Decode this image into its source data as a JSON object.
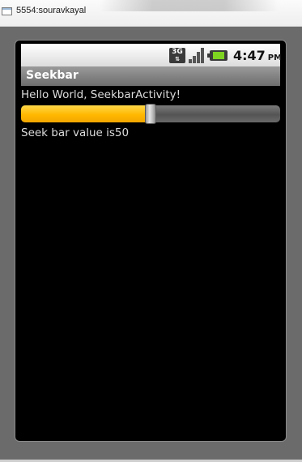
{
  "window": {
    "title": "5554:souravkayal"
  },
  "statusbar": {
    "network": "3G",
    "time": "4:47",
    "ampm": "PM",
    "icons": [
      "3g-data-icon",
      "signal-icon",
      "battery-charging-icon"
    ],
    "battery_color": "#7ed321"
  },
  "app": {
    "title": "Seekbar",
    "hello_text": "Hello World, SeekbarActivity!",
    "seekbar": {
      "progress": 50,
      "max": 100,
      "fill_color": "#ffb800"
    },
    "value_text": "Seek bar value is50"
  }
}
